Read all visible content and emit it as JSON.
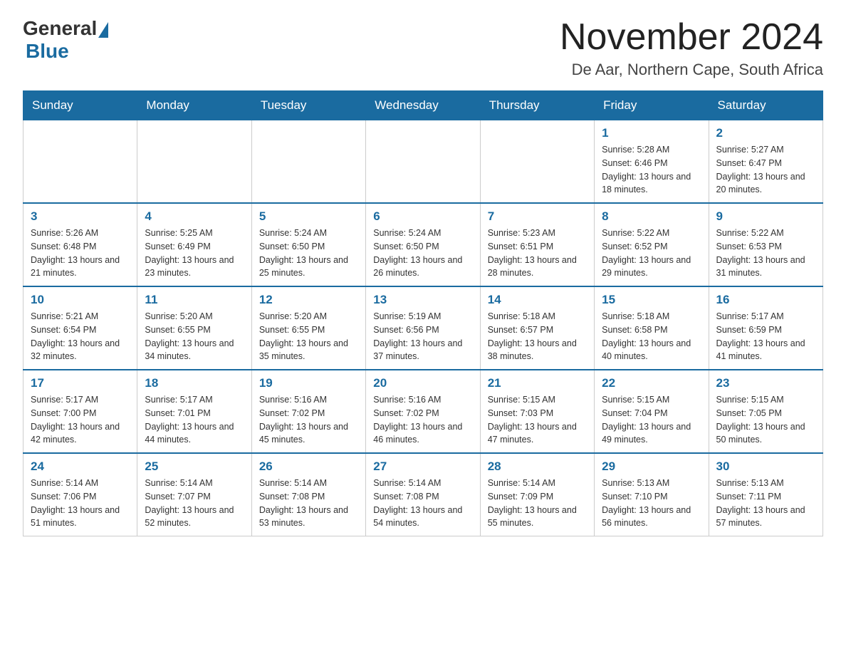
{
  "header": {
    "logo_general": "General",
    "logo_blue": "Blue",
    "month_title": "November 2024",
    "location": "De Aar, Northern Cape, South Africa"
  },
  "days_of_week": [
    "Sunday",
    "Monday",
    "Tuesday",
    "Wednesday",
    "Thursday",
    "Friday",
    "Saturday"
  ],
  "weeks": [
    [
      {
        "day": "",
        "info": ""
      },
      {
        "day": "",
        "info": ""
      },
      {
        "day": "",
        "info": ""
      },
      {
        "day": "",
        "info": ""
      },
      {
        "day": "",
        "info": ""
      },
      {
        "day": "1",
        "info": "Sunrise: 5:28 AM\nSunset: 6:46 PM\nDaylight: 13 hours and 18 minutes."
      },
      {
        "day": "2",
        "info": "Sunrise: 5:27 AM\nSunset: 6:47 PM\nDaylight: 13 hours and 20 minutes."
      }
    ],
    [
      {
        "day": "3",
        "info": "Sunrise: 5:26 AM\nSunset: 6:48 PM\nDaylight: 13 hours and 21 minutes."
      },
      {
        "day": "4",
        "info": "Sunrise: 5:25 AM\nSunset: 6:49 PM\nDaylight: 13 hours and 23 minutes."
      },
      {
        "day": "5",
        "info": "Sunrise: 5:24 AM\nSunset: 6:50 PM\nDaylight: 13 hours and 25 minutes."
      },
      {
        "day": "6",
        "info": "Sunrise: 5:24 AM\nSunset: 6:50 PM\nDaylight: 13 hours and 26 minutes."
      },
      {
        "day": "7",
        "info": "Sunrise: 5:23 AM\nSunset: 6:51 PM\nDaylight: 13 hours and 28 minutes."
      },
      {
        "day": "8",
        "info": "Sunrise: 5:22 AM\nSunset: 6:52 PM\nDaylight: 13 hours and 29 minutes."
      },
      {
        "day": "9",
        "info": "Sunrise: 5:22 AM\nSunset: 6:53 PM\nDaylight: 13 hours and 31 minutes."
      }
    ],
    [
      {
        "day": "10",
        "info": "Sunrise: 5:21 AM\nSunset: 6:54 PM\nDaylight: 13 hours and 32 minutes."
      },
      {
        "day": "11",
        "info": "Sunrise: 5:20 AM\nSunset: 6:55 PM\nDaylight: 13 hours and 34 minutes."
      },
      {
        "day": "12",
        "info": "Sunrise: 5:20 AM\nSunset: 6:55 PM\nDaylight: 13 hours and 35 minutes."
      },
      {
        "day": "13",
        "info": "Sunrise: 5:19 AM\nSunset: 6:56 PM\nDaylight: 13 hours and 37 minutes."
      },
      {
        "day": "14",
        "info": "Sunrise: 5:18 AM\nSunset: 6:57 PM\nDaylight: 13 hours and 38 minutes."
      },
      {
        "day": "15",
        "info": "Sunrise: 5:18 AM\nSunset: 6:58 PM\nDaylight: 13 hours and 40 minutes."
      },
      {
        "day": "16",
        "info": "Sunrise: 5:17 AM\nSunset: 6:59 PM\nDaylight: 13 hours and 41 minutes."
      }
    ],
    [
      {
        "day": "17",
        "info": "Sunrise: 5:17 AM\nSunset: 7:00 PM\nDaylight: 13 hours and 42 minutes."
      },
      {
        "day": "18",
        "info": "Sunrise: 5:17 AM\nSunset: 7:01 PM\nDaylight: 13 hours and 44 minutes."
      },
      {
        "day": "19",
        "info": "Sunrise: 5:16 AM\nSunset: 7:02 PM\nDaylight: 13 hours and 45 minutes."
      },
      {
        "day": "20",
        "info": "Sunrise: 5:16 AM\nSunset: 7:02 PM\nDaylight: 13 hours and 46 minutes."
      },
      {
        "day": "21",
        "info": "Sunrise: 5:15 AM\nSunset: 7:03 PM\nDaylight: 13 hours and 47 minutes."
      },
      {
        "day": "22",
        "info": "Sunrise: 5:15 AM\nSunset: 7:04 PM\nDaylight: 13 hours and 49 minutes."
      },
      {
        "day": "23",
        "info": "Sunrise: 5:15 AM\nSunset: 7:05 PM\nDaylight: 13 hours and 50 minutes."
      }
    ],
    [
      {
        "day": "24",
        "info": "Sunrise: 5:14 AM\nSunset: 7:06 PM\nDaylight: 13 hours and 51 minutes."
      },
      {
        "day": "25",
        "info": "Sunrise: 5:14 AM\nSunset: 7:07 PM\nDaylight: 13 hours and 52 minutes."
      },
      {
        "day": "26",
        "info": "Sunrise: 5:14 AM\nSunset: 7:08 PM\nDaylight: 13 hours and 53 minutes."
      },
      {
        "day": "27",
        "info": "Sunrise: 5:14 AM\nSunset: 7:08 PM\nDaylight: 13 hours and 54 minutes."
      },
      {
        "day": "28",
        "info": "Sunrise: 5:14 AM\nSunset: 7:09 PM\nDaylight: 13 hours and 55 minutes."
      },
      {
        "day": "29",
        "info": "Sunrise: 5:13 AM\nSunset: 7:10 PM\nDaylight: 13 hours and 56 minutes."
      },
      {
        "day": "30",
        "info": "Sunrise: 5:13 AM\nSunset: 7:11 PM\nDaylight: 13 hours and 57 minutes."
      }
    ]
  ]
}
